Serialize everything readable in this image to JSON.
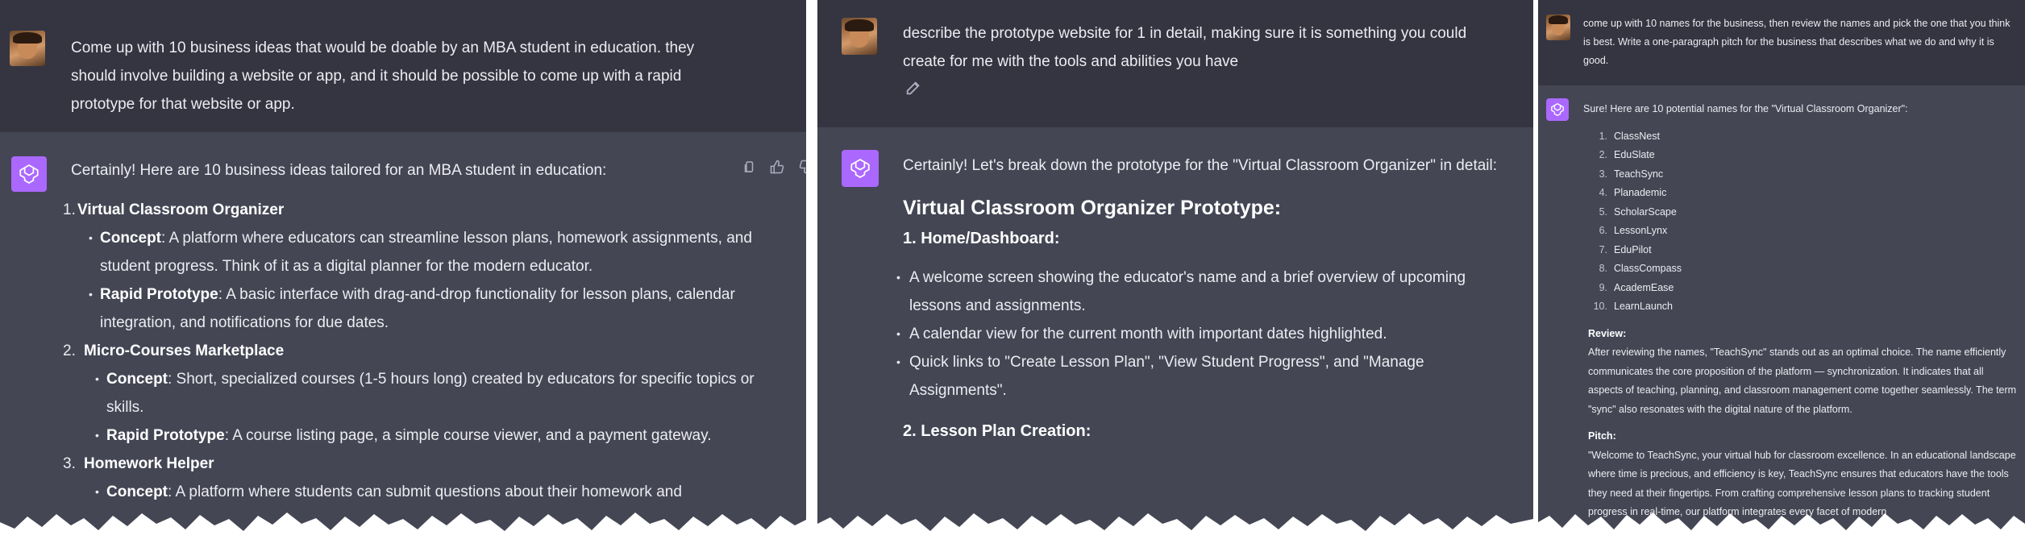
{
  "panel1": {
    "user_message": "Come up with 10 business ideas that would be doable by an MBA student in education. they should involve building a website or app, and it should be possible to come up with a rapid prototype for that website or app.",
    "assistant_intro": "Certainly! Here are 10 business ideas tailored for an MBA student in education:",
    "ideas": [
      {
        "num": "1.",
        "title": "Virtual Classroom Organizer",
        "points": [
          {
            "label": "Concept",
            "text": ": A platform where educators can streamline lesson plans, homework assignments, and student progress. Think of it as a digital planner for the modern educator."
          },
          {
            "label": "Rapid Prototype",
            "text": ": A basic interface with drag-and-drop functionality for lesson plans, calendar integration, and notifications for due dates."
          }
        ]
      },
      {
        "num": "2.",
        "title": "Micro-Courses Marketplace",
        "points": [
          {
            "label": "Concept",
            "text": ": Short, specialized courses (1-5 hours long) created by educators for specific topics or skills."
          },
          {
            "label": "Rapid Prototype",
            "text": ": A course listing page, a simple course viewer, and a payment gateway."
          }
        ]
      },
      {
        "num": "3.",
        "title": "Homework Helper",
        "points": [
          {
            "label": "Concept",
            "text": ": A platform where students can submit questions about their homework and"
          }
        ]
      }
    ]
  },
  "panel2": {
    "user_message": "describe the prototype website for 1 in detail, making sure it is something you could create for me with the tools and abilities you have",
    "assistant_intro": "Certainly! Let's break down the prototype for the \"Virtual Classroom Organizer\" in detail:",
    "heading": "Virtual Classroom Organizer Prototype:",
    "section1_title": "1. Home/Dashboard:",
    "section1_points": [
      "A welcome screen showing the educator's name and a brief overview of upcoming lessons and assignments.",
      "A calendar view for the current month with important dates highlighted.",
      "Quick links to \"Create Lesson Plan\", \"View Student Progress\", and \"Manage Assignments\"."
    ],
    "section2_title": "2. Lesson Plan Creation:"
  },
  "panel3": {
    "user_message": "come up with 10 names for the business, then review the names and pick the one that you think is best. Write a one-paragraph pitch for the business that describes what we do and why it is good.",
    "assistant_intro": "Sure! Here are 10 potential names for the \"Virtual Classroom Organizer\":",
    "names": [
      {
        "num": "1.",
        "name": "ClassNest"
      },
      {
        "num": "2.",
        "name": "EduSlate"
      },
      {
        "num": "3.",
        "name": "TeachSync"
      },
      {
        "num": "4.",
        "name": "Planademic"
      },
      {
        "num": "5.",
        "name": "ScholarScape"
      },
      {
        "num": "6.",
        "name": "LessonLynx"
      },
      {
        "num": "7.",
        "name": "EduPilot"
      },
      {
        "num": "8.",
        "name": "ClassCompass"
      },
      {
        "num": "9.",
        "name": "AcademEase"
      },
      {
        "num": "10.",
        "name": "LearnLaunch"
      }
    ],
    "review_label": "Review",
    "review_text": "After reviewing the names, \"TeachSync\" stands out as an optimal choice. The name efficiently communicates the core proposition of the platform — synchronization. It indicates that all aspects of teaching, planning, and classroom management come together seamlessly. The term \"sync\" also resonates with the digital nature of the platform.",
    "pitch_label": "Pitch",
    "pitch_text": "\"Welcome to TeachSync, your virtual hub for classroom excellence. In an educational landscape where time is precious, and efficiency is key, TeachSync ensures that educators have the tools they need at their fingertips. From crafting comprehensive lesson plans to tracking student progress in real-time, our platform integrates every facet of modern"
  },
  "colors": {
    "user_bg": "#343541",
    "assistant_bg": "#444654",
    "gpt_logo": "#ab68ff",
    "text": "#ececf1"
  },
  "icons": [
    "user-avatar",
    "chatgpt-logo-icon",
    "copy-icon",
    "thumbs-up-icon",
    "thumbs-down-icon",
    "edit-icon"
  ]
}
